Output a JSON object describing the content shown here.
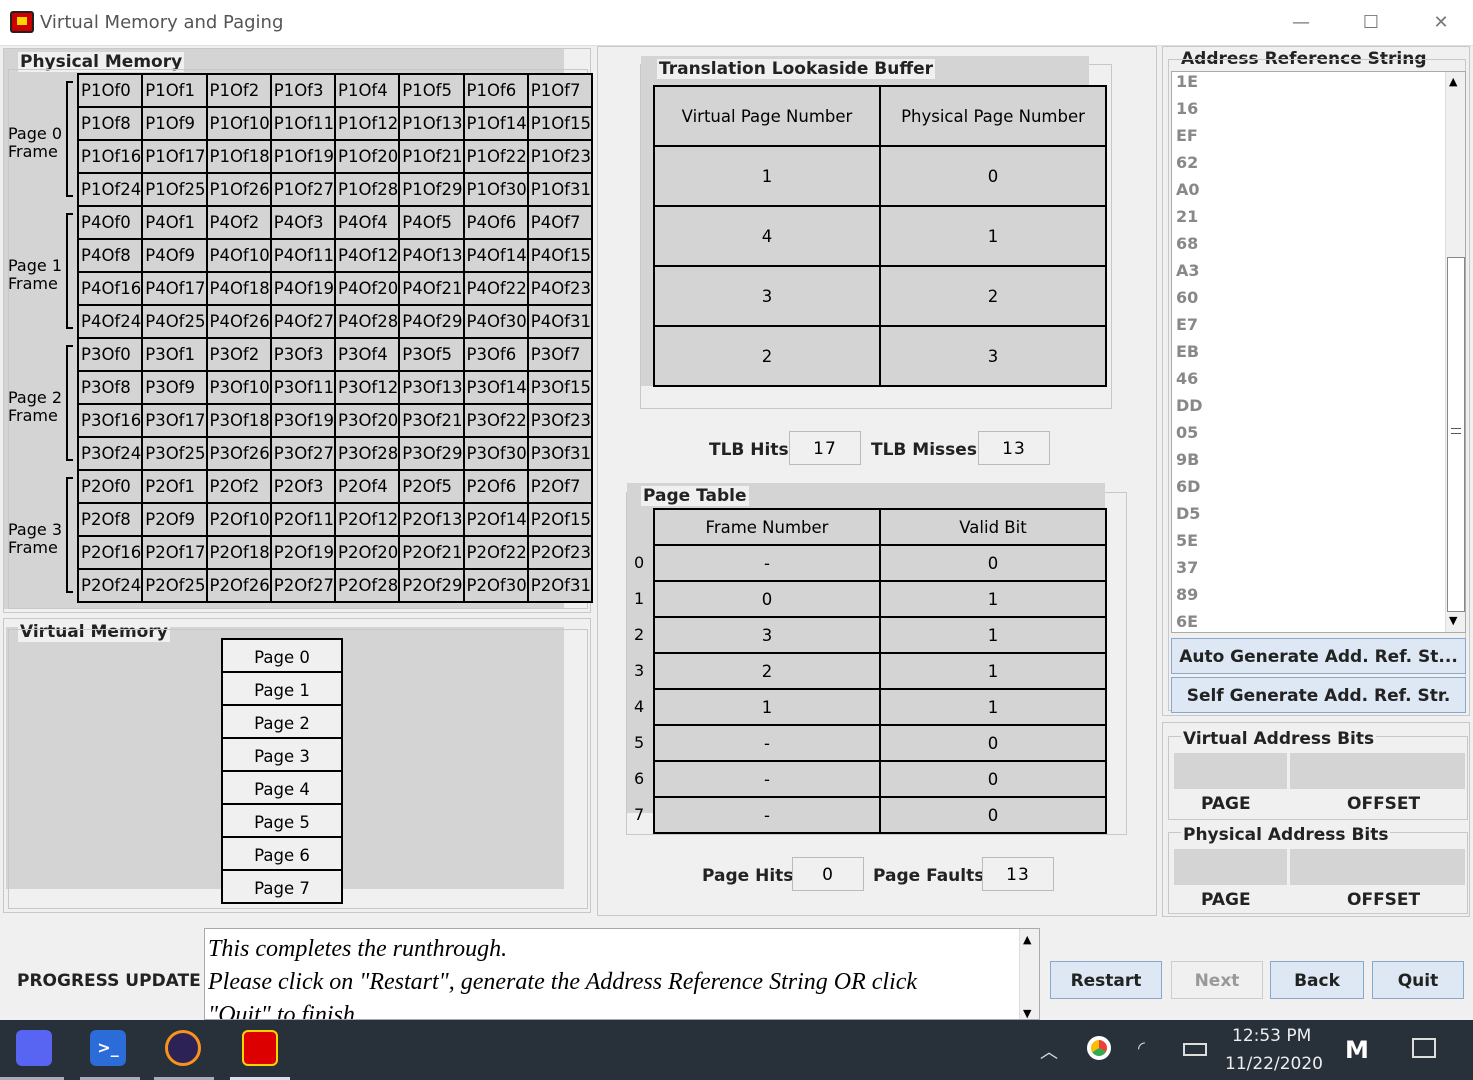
{
  "window": {
    "title": "Virtual Memory and Paging",
    "minimize": "—",
    "maximize": "☐",
    "close": "✕"
  },
  "physical_memory": {
    "title": "Physical Memory",
    "frames": [
      {
        "label_line1": "Page 0",
        "label_line2": "Frame",
        "rows": [
          [
            "P1Of0",
            "P1Of1",
            "P1Of2",
            "P1Of3",
            "P1Of4",
            "P1Of5",
            "P1Of6",
            "P1Of7"
          ],
          [
            "P1Of8",
            "P1Of9",
            "P1Of10",
            "P1Of11",
            "P1Of12",
            "P1Of13",
            "P1Of14",
            "P1Of15"
          ],
          [
            "P1Of16",
            "P1Of17",
            "P1Of18",
            "P1Of19",
            "P1Of20",
            "P1Of21",
            "P1Of22",
            "P1Of23"
          ],
          [
            "P1Of24",
            "P1Of25",
            "P1Of26",
            "P1Of27",
            "P1Of28",
            "P1Of29",
            "P1Of30",
            "P1Of31"
          ]
        ]
      },
      {
        "label_line1": "Page 1",
        "label_line2": "Frame",
        "rows": [
          [
            "P4Of0",
            "P4Of1",
            "P4Of2",
            "P4Of3",
            "P4Of4",
            "P4Of5",
            "P4Of6",
            "P4Of7"
          ],
          [
            "P4Of8",
            "P4Of9",
            "P4Of10",
            "P4Of11",
            "P4Of12",
            "P4Of13",
            "P4Of14",
            "P4Of15"
          ],
          [
            "P4Of16",
            "P4Of17",
            "P4Of18",
            "P4Of19",
            "P4Of20",
            "P4Of21",
            "P4Of22",
            "P4Of23"
          ],
          [
            "P4Of24",
            "P4Of25",
            "P4Of26",
            "P4Of27",
            "P4Of28",
            "P4Of29",
            "P4Of30",
            "P4Of31"
          ]
        ]
      },
      {
        "label_line1": "Page 2",
        "label_line2": "Frame",
        "rows": [
          [
            "P3Of0",
            "P3Of1",
            "P3Of2",
            "P3Of3",
            "P3Of4",
            "P3Of5",
            "P3Of6",
            "P3Of7"
          ],
          [
            "P3Of8",
            "P3Of9",
            "P3Of10",
            "P3Of11",
            "P3Of12",
            "P3Of13",
            "P3Of14",
            "P3Of15"
          ],
          [
            "P3Of16",
            "P3Of17",
            "P3Of18",
            "P3Of19",
            "P3Of20",
            "P3Of21",
            "P3Of22",
            "P3Of23"
          ],
          [
            "P3Of24",
            "P3Of25",
            "P3Of26",
            "P3Of27",
            "P3Of28",
            "P3Of29",
            "P3Of30",
            "P3Of31"
          ]
        ]
      },
      {
        "label_line1": "Page 3",
        "label_line2": "Frame",
        "rows": [
          [
            "P2Of0",
            "P2Of1",
            "P2Of2",
            "P2Of3",
            "P2Of4",
            "P2Of5",
            "P2Of6",
            "P2Of7"
          ],
          [
            "P2Of8",
            "P2Of9",
            "P2Of10",
            "P2Of11",
            "P2Of12",
            "P2Of13",
            "P2Of14",
            "P2Of15"
          ],
          [
            "P2Of16",
            "P2Of17",
            "P2Of18",
            "P2Of19",
            "P2Of20",
            "P2Of21",
            "P2Of22",
            "P2Of23"
          ],
          [
            "P2Of24",
            "P2Of25",
            "P2Of26",
            "P2Of27",
            "P2Of28",
            "P2Of29",
            "P2Of30",
            "P2Of31"
          ]
        ]
      }
    ]
  },
  "virtual_memory": {
    "title": "Virtual Memory",
    "pages": [
      "Page 0",
      "Page 1",
      "Page 2",
      "Page 3",
      "Page 4",
      "Page 5",
      "Page 6",
      "Page 7"
    ]
  },
  "tlb": {
    "title": "Translation Lookaside Buffer",
    "headers": [
      "Virtual Page Number",
      "Physical Page Number"
    ],
    "rows": [
      [
        "1",
        "0"
      ],
      [
        "4",
        "1"
      ],
      [
        "3",
        "2"
      ],
      [
        "2",
        "3"
      ]
    ],
    "hits_label": "TLB Hits",
    "hits_value": "17",
    "misses_label": "TLB Misses",
    "misses_value": "13"
  },
  "page_table": {
    "title": "Page Table",
    "headers": [
      "Frame Number",
      "Valid Bit"
    ],
    "rows": [
      {
        "index": "0",
        "frame": "-",
        "valid": "0"
      },
      {
        "index": "1",
        "frame": "0",
        "valid": "1"
      },
      {
        "index": "2",
        "frame": "3",
        "valid": "1"
      },
      {
        "index": "3",
        "frame": "2",
        "valid": "1"
      },
      {
        "index": "4",
        "frame": "1",
        "valid": "1"
      },
      {
        "index": "5",
        "frame": "-",
        "valid": "0"
      },
      {
        "index": "6",
        "frame": "-",
        "valid": "0"
      },
      {
        "index": "7",
        "frame": "-",
        "valid": "0"
      }
    ],
    "hits_label": "Page Hits",
    "hits_value": "0",
    "faults_label": "Page Faults",
    "faults_value": "13"
  },
  "address_ref": {
    "title": "Address Reference String",
    "items": [
      "1E",
      "16",
      "EF",
      "62",
      "A0",
      "21",
      "68",
      "A3",
      "60",
      "E7",
      "EB",
      "46",
      "DD",
      "05",
      "9B",
      "6D",
      "D5",
      "5E",
      "37",
      "89",
      "6E"
    ],
    "auto_button": "Auto Generate Add. Ref. St...",
    "self_button": "Self Generate Add. Ref. Str."
  },
  "virtual_bits": {
    "title": "Virtual Address Bits",
    "page_label": "PAGE",
    "offset_label": "OFFSET"
  },
  "physical_bits": {
    "title": "Physical Address Bits",
    "page_label": "PAGE",
    "offset_label": "OFFSET"
  },
  "progress": {
    "label": "PROGRESS UPDATE",
    "line1": "This completes the runthrough.",
    "line2": "Please click on \"Restart\", generate the Address Reference String OR click",
    "line3": "\"Quit\" to finish."
  },
  "buttons": {
    "restart": "Restart",
    "next": "Next",
    "back": "Back",
    "quit": "Quit"
  },
  "taskbar": {
    "time": "12:53 PM",
    "date": "11/22/2020"
  }
}
